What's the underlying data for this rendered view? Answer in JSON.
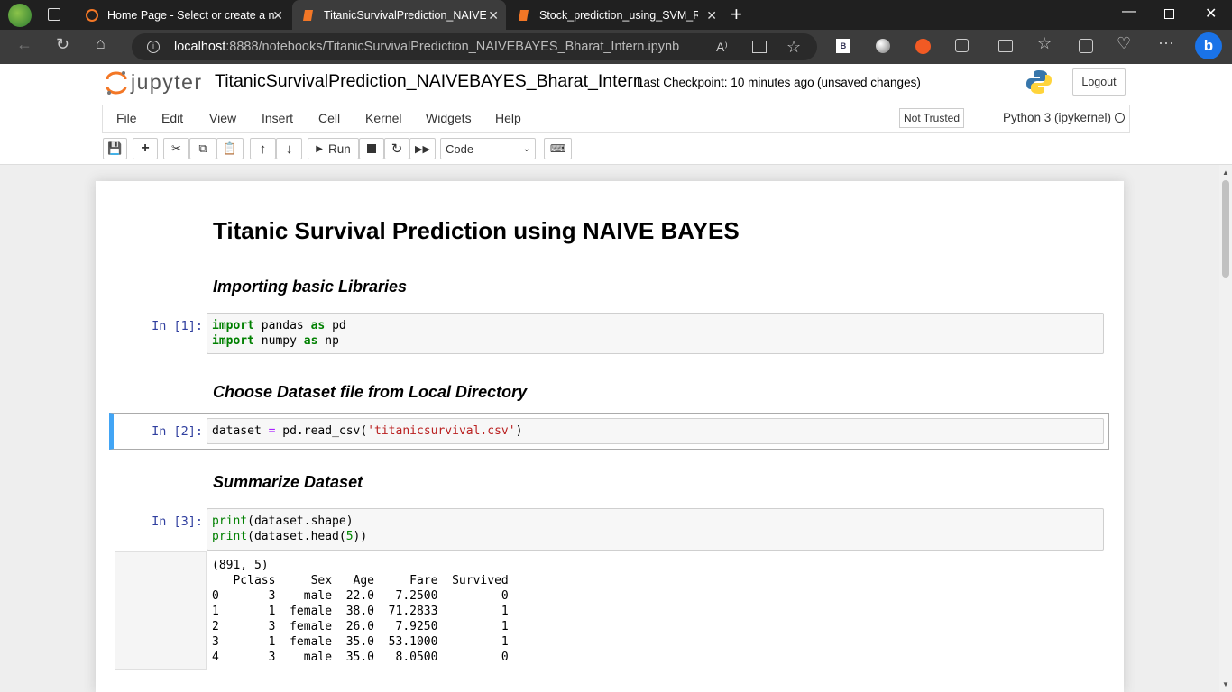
{
  "browser": {
    "tabs": [
      {
        "title": "Home Page - Select or create a n",
        "active": false
      },
      {
        "title": "TitanicSurvivalPrediction_NAIVEB",
        "active": true
      },
      {
        "title": "Stock_prediction_using_SVM_REG",
        "active": false
      }
    ],
    "url_host": "localhost",
    "url_rest": ":8888/notebooks/TitanicSurvivalPrediction_NAIVEBAYES_Bharat_Intern.ipynb"
  },
  "jupyter": {
    "logo_text": "jupyter",
    "notebook_name": "TitanicSurvivalPrediction_NAIVEBAYES_Bharat_Intern",
    "checkpoint": "Last Checkpoint: 10 minutes ago",
    "unsaved": "(unsaved changes)",
    "logout": "Logout",
    "menu": [
      "File",
      "Edit",
      "View",
      "Insert",
      "Cell",
      "Kernel",
      "Widgets",
      "Help"
    ],
    "trust": "Not Trusted",
    "kernel": "Python 3 (ipykernel)",
    "run_label": "Run",
    "cell_type": "Code"
  },
  "notebook": {
    "title": "Titanic Survival Prediction using NAIVE BAYES",
    "h_import": "Importing basic Libraries",
    "h_choose": "Choose Dataset file from Local Directory",
    "h_summarize": "Summarize Dataset",
    "prompt1": "In [1]:",
    "prompt2": "In [2]:",
    "prompt3": "In [3]:",
    "code1_l1": [
      "import",
      " pandas ",
      "as",
      " pd"
    ],
    "code1_l2": [
      "import",
      " numpy ",
      "as",
      " np"
    ],
    "code2": [
      "dataset ",
      "=",
      " pd.read_csv(",
      "'titanicsurvival.csv'",
      ")"
    ],
    "code3_l1": [
      "print",
      "(dataset.shape)"
    ],
    "code3_l2": [
      "print",
      "(dataset.head(",
      "5",
      "))"
    ],
    "output": "(891, 5)\n   Pclass     Sex   Age     Fare  Survived\n0       3    male  22.0   7.2500         0\n1       1  female  38.0  71.2833         1\n2       3  female  26.0   7.9250         1\n3       1  female  35.0  53.1000         1\n4       3    male  35.0   8.0500         0"
  }
}
